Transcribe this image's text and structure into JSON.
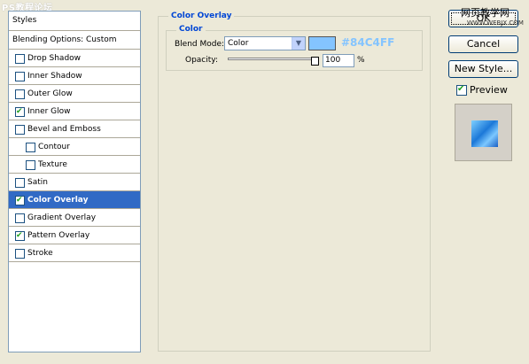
{
  "watermark": "PS教程论坛",
  "styles_panel": {
    "header": "Styles",
    "blending_options": "Blending Options: Custom",
    "items": [
      {
        "label": "Drop Shadow",
        "checked": false,
        "indent": false,
        "selected": false
      },
      {
        "label": "Inner Shadow",
        "checked": false,
        "indent": false,
        "selected": false
      },
      {
        "label": "Outer Glow",
        "checked": false,
        "indent": false,
        "selected": false
      },
      {
        "label": "Inner Glow",
        "checked": true,
        "indent": false,
        "selected": false
      },
      {
        "label": "Bevel and Emboss",
        "checked": false,
        "indent": false,
        "selected": false
      },
      {
        "label": "Contour",
        "checked": false,
        "indent": true,
        "selected": false
      },
      {
        "label": "Texture",
        "checked": false,
        "indent": true,
        "selected": false
      },
      {
        "label": "Satin",
        "checked": false,
        "indent": false,
        "selected": false
      },
      {
        "label": "Color Overlay",
        "checked": true,
        "indent": false,
        "selected": true
      },
      {
        "label": "Gradient Overlay",
        "checked": false,
        "indent": false,
        "selected": false
      },
      {
        "label": "Pattern Overlay",
        "checked": true,
        "indent": false,
        "selected": false
      },
      {
        "label": "Stroke",
        "checked": false,
        "indent": false,
        "selected": false
      }
    ]
  },
  "color_overlay": {
    "title": "Color Overlay",
    "subgroup_title": "Color",
    "blend_mode_label": "Blend Mode:",
    "blend_mode_value": "Color",
    "color_hex": "#84C4FF",
    "color_swatch": "#84c4ff",
    "opacity_label": "Opacity:",
    "opacity_value": "100",
    "opacity_unit": "%",
    "opacity_level": 1.0
  },
  "buttons": {
    "ok": "OK",
    "cancel": "Cancel",
    "new_style": "New Style..."
  },
  "watermark_cn": "网页教学网",
  "watermark_url": "WWW.WEBJX.COM",
  "preview": {
    "label": "Preview",
    "checked": true
  }
}
